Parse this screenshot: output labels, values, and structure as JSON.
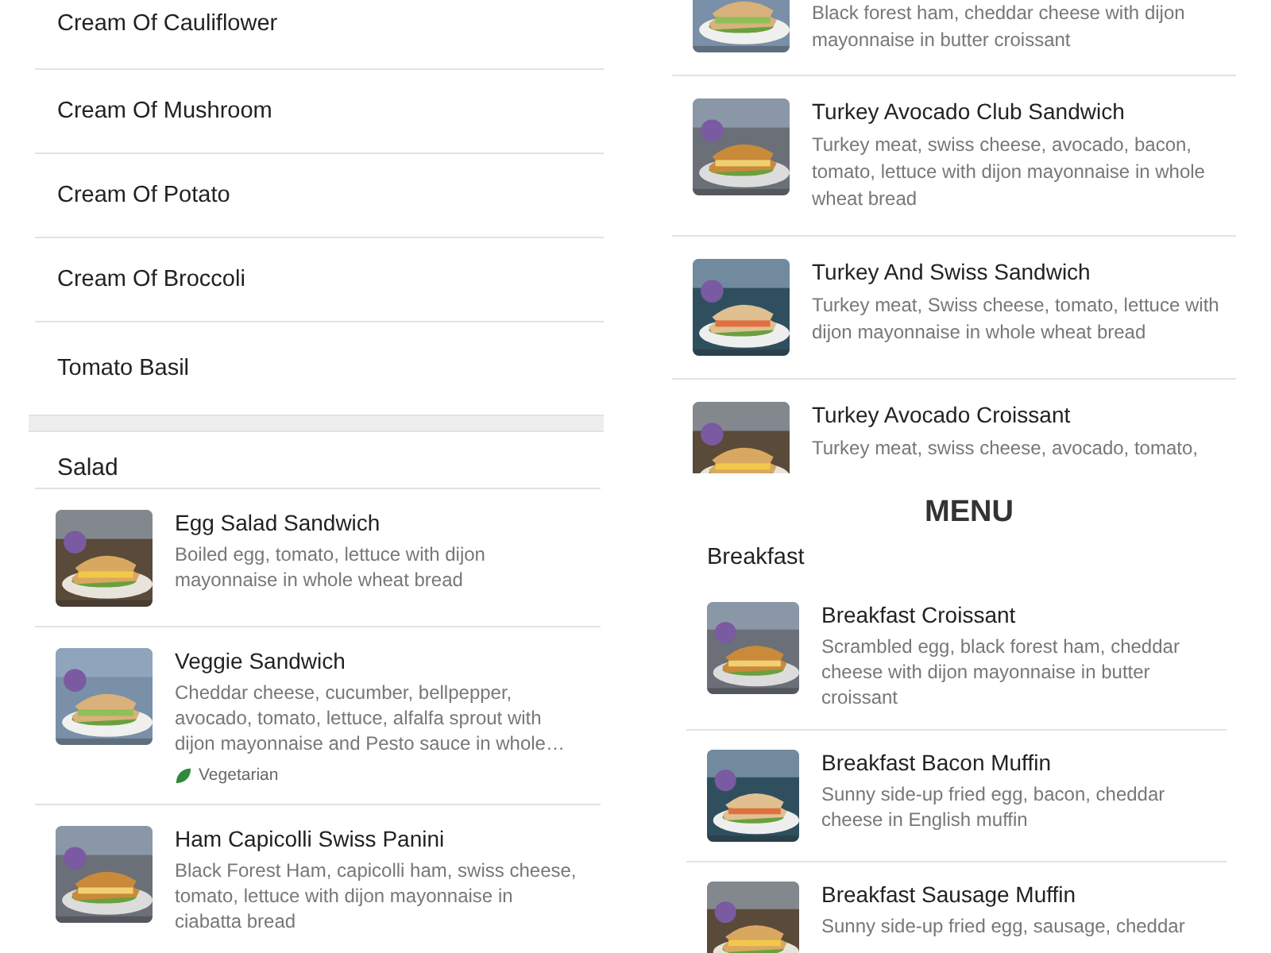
{
  "left_panel": {
    "soups": [
      "Cream Of Cauliflower",
      "Cream Of Mushroom",
      "Cream Of Potato",
      "Cream Of Broccoli",
      "Tomato Basil"
    ],
    "section": {
      "title": "Salad",
      "items": [
        {
          "name": "Egg Salad Sandwich",
          "description": "Boiled egg, tomato, lettuce with dijon mayonnaise in whole wheat bread"
        },
        {
          "name": "Veggie Sandwich",
          "description": "Cheddar cheese, cucumber, bellpepper, avocado, tomato, lettuce, alfalfa sprout with dijon mayonnaise and Pesto sauce in whole…",
          "tag": "Vegetarian"
        },
        {
          "name": "Ham Capicolli Swiss Panini",
          "description": "Black Forest Ham, capicolli ham, swiss cheese, tomato, lettuce with dijon mayonnaise in ciabatta bread"
        }
      ]
    }
  },
  "right_top_panel": {
    "items": [
      {
        "description": "Black forest ham, cheddar cheese with dijon mayonnaise in butter croissant"
      },
      {
        "name": "Turkey Avocado Club Sandwich",
        "description": "Turkey meat, swiss cheese, avocado, bacon, tomato, lettuce with dijon mayonnaise in whole wheat bread"
      },
      {
        "name": "Turkey And Swiss Sandwich",
        "description": "Turkey meat, Swiss cheese, tomato, lettuce with dijon mayonnaise in whole wheat bread"
      },
      {
        "name": "Turkey Avocado Croissant",
        "description": "Turkey meat, swiss cheese, avocado, tomato,"
      }
    ]
  },
  "right_bottom_panel": {
    "title": "MENU",
    "section": "Breakfast",
    "items": [
      {
        "name": "Breakfast Croissant",
        "description": "Scrambled egg, black forest ham, cheddar cheese with dijon mayonnaise in butter croissant"
      },
      {
        "name": "Breakfast Bacon Muffin",
        "description": "Sunny side-up fried egg, bacon, cheddar cheese in English muffin"
      },
      {
        "name": "Breakfast Sausage Muffin",
        "description": "Sunny side-up fried egg, sausage, cheddar"
      }
    ]
  }
}
